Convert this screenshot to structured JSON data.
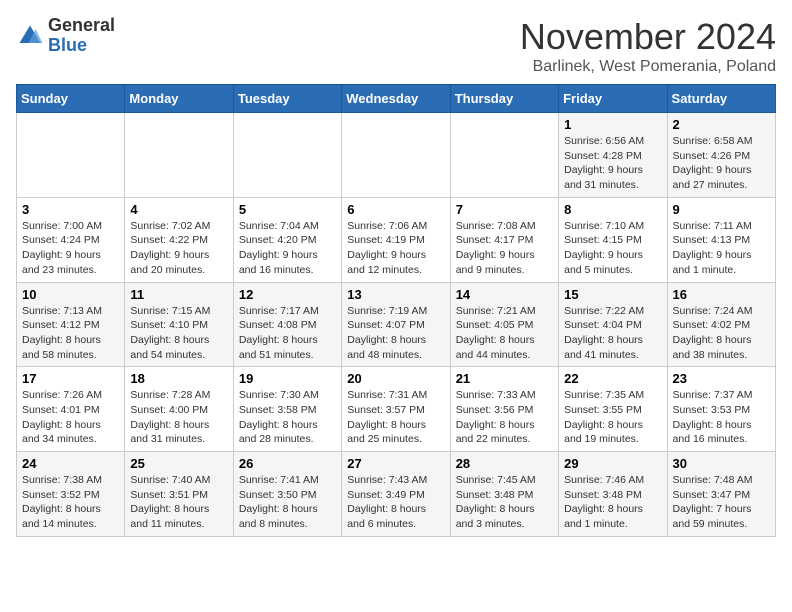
{
  "logo": {
    "general": "General",
    "blue": "Blue"
  },
  "title": "November 2024",
  "subtitle": "Barlinek, West Pomerania, Poland",
  "days_of_week": [
    "Sunday",
    "Monday",
    "Tuesday",
    "Wednesday",
    "Thursday",
    "Friday",
    "Saturday"
  ],
  "weeks": [
    [
      {
        "day": "",
        "info": ""
      },
      {
        "day": "",
        "info": ""
      },
      {
        "day": "",
        "info": ""
      },
      {
        "day": "",
        "info": ""
      },
      {
        "day": "",
        "info": ""
      },
      {
        "day": "1",
        "info": "Sunrise: 6:56 AM\nSunset: 4:28 PM\nDaylight: 9 hours and 31 minutes."
      },
      {
        "day": "2",
        "info": "Sunrise: 6:58 AM\nSunset: 4:26 PM\nDaylight: 9 hours and 27 minutes."
      }
    ],
    [
      {
        "day": "3",
        "info": "Sunrise: 7:00 AM\nSunset: 4:24 PM\nDaylight: 9 hours and 23 minutes."
      },
      {
        "day": "4",
        "info": "Sunrise: 7:02 AM\nSunset: 4:22 PM\nDaylight: 9 hours and 20 minutes."
      },
      {
        "day": "5",
        "info": "Sunrise: 7:04 AM\nSunset: 4:20 PM\nDaylight: 9 hours and 16 minutes."
      },
      {
        "day": "6",
        "info": "Sunrise: 7:06 AM\nSunset: 4:19 PM\nDaylight: 9 hours and 12 minutes."
      },
      {
        "day": "7",
        "info": "Sunrise: 7:08 AM\nSunset: 4:17 PM\nDaylight: 9 hours and 9 minutes."
      },
      {
        "day": "8",
        "info": "Sunrise: 7:10 AM\nSunset: 4:15 PM\nDaylight: 9 hours and 5 minutes."
      },
      {
        "day": "9",
        "info": "Sunrise: 7:11 AM\nSunset: 4:13 PM\nDaylight: 9 hours and 1 minute."
      }
    ],
    [
      {
        "day": "10",
        "info": "Sunrise: 7:13 AM\nSunset: 4:12 PM\nDaylight: 8 hours and 58 minutes."
      },
      {
        "day": "11",
        "info": "Sunrise: 7:15 AM\nSunset: 4:10 PM\nDaylight: 8 hours and 54 minutes."
      },
      {
        "day": "12",
        "info": "Sunrise: 7:17 AM\nSunset: 4:08 PM\nDaylight: 8 hours and 51 minutes."
      },
      {
        "day": "13",
        "info": "Sunrise: 7:19 AM\nSunset: 4:07 PM\nDaylight: 8 hours and 48 minutes."
      },
      {
        "day": "14",
        "info": "Sunrise: 7:21 AM\nSunset: 4:05 PM\nDaylight: 8 hours and 44 minutes."
      },
      {
        "day": "15",
        "info": "Sunrise: 7:22 AM\nSunset: 4:04 PM\nDaylight: 8 hours and 41 minutes."
      },
      {
        "day": "16",
        "info": "Sunrise: 7:24 AM\nSunset: 4:02 PM\nDaylight: 8 hours and 38 minutes."
      }
    ],
    [
      {
        "day": "17",
        "info": "Sunrise: 7:26 AM\nSunset: 4:01 PM\nDaylight: 8 hours and 34 minutes."
      },
      {
        "day": "18",
        "info": "Sunrise: 7:28 AM\nSunset: 4:00 PM\nDaylight: 8 hours and 31 minutes."
      },
      {
        "day": "19",
        "info": "Sunrise: 7:30 AM\nSunset: 3:58 PM\nDaylight: 8 hours and 28 minutes."
      },
      {
        "day": "20",
        "info": "Sunrise: 7:31 AM\nSunset: 3:57 PM\nDaylight: 8 hours and 25 minutes."
      },
      {
        "day": "21",
        "info": "Sunrise: 7:33 AM\nSunset: 3:56 PM\nDaylight: 8 hours and 22 minutes."
      },
      {
        "day": "22",
        "info": "Sunrise: 7:35 AM\nSunset: 3:55 PM\nDaylight: 8 hours and 19 minutes."
      },
      {
        "day": "23",
        "info": "Sunrise: 7:37 AM\nSunset: 3:53 PM\nDaylight: 8 hours and 16 minutes."
      }
    ],
    [
      {
        "day": "24",
        "info": "Sunrise: 7:38 AM\nSunset: 3:52 PM\nDaylight: 8 hours and 14 minutes."
      },
      {
        "day": "25",
        "info": "Sunrise: 7:40 AM\nSunset: 3:51 PM\nDaylight: 8 hours and 11 minutes."
      },
      {
        "day": "26",
        "info": "Sunrise: 7:41 AM\nSunset: 3:50 PM\nDaylight: 8 hours and 8 minutes."
      },
      {
        "day": "27",
        "info": "Sunrise: 7:43 AM\nSunset: 3:49 PM\nDaylight: 8 hours and 6 minutes."
      },
      {
        "day": "28",
        "info": "Sunrise: 7:45 AM\nSunset: 3:48 PM\nDaylight: 8 hours and 3 minutes."
      },
      {
        "day": "29",
        "info": "Sunrise: 7:46 AM\nSunset: 3:48 PM\nDaylight: 8 hours and 1 minute."
      },
      {
        "day": "30",
        "info": "Sunrise: 7:48 AM\nSunset: 3:47 PM\nDaylight: 7 hours and 59 minutes."
      }
    ]
  ]
}
